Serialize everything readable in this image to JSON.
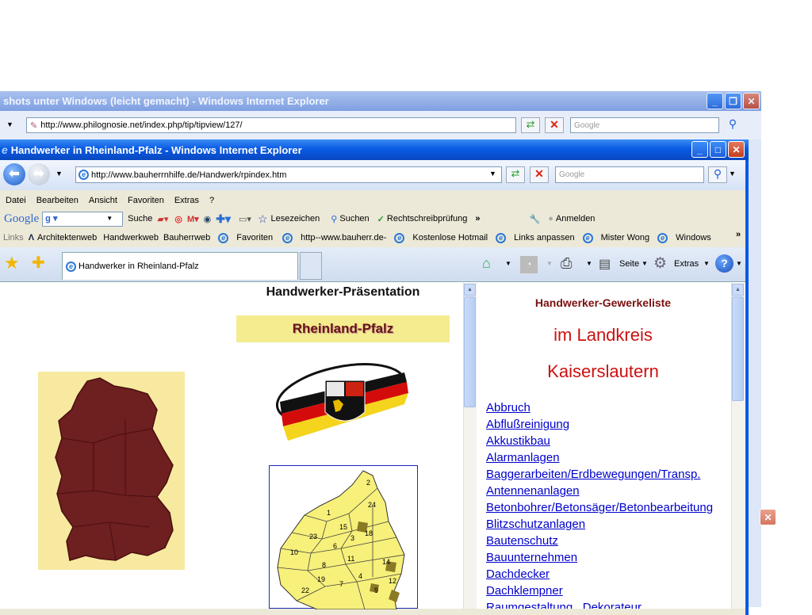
{
  "back_window": {
    "title": "shots unter Windows (leicht gemacht) - Windows Internet Explorer",
    "address": "http://www.philognosie.net/index.php/tip/tipview/127/",
    "search_placeholder": "Google"
  },
  "window": {
    "title": "Handwerker in Rheinland-Pfalz - Windows Internet Explorer",
    "address": "http://www.bauherrnhilfe.de/Handwerk/rpindex.htm",
    "search_placeholder": "Google"
  },
  "menu": [
    "Datei",
    "Bearbeiten",
    "Ansicht",
    "Favoriten",
    "Extras",
    "?"
  ],
  "google_toolbar": {
    "logo": "Google",
    "search_btn": "Suche",
    "bookmarks": "Lesezeichen",
    "search2": "Suchen",
    "spell": "Rechtschreibprüfung",
    "signin": "Anmelden"
  },
  "links_bar": {
    "label": "Links",
    "items": [
      "Architektenweb",
      "Handwerkweb",
      "Bauherrweb",
      "Favoriten",
      "http--www.bauherr.de-",
      "Kostenlose Hotmail",
      "Links anpassen",
      "Mister Wong",
      "Windows"
    ]
  },
  "tab": {
    "label": "Handwerker in Rheinland-Pfalz"
  },
  "command_bar": {
    "page": "Seite",
    "extras": "Extras"
  },
  "page": {
    "heading": "Handwerker-Präsentation",
    "banner": "Rheinland-Pfalz",
    "list_title": "Handwerker-Gewerkeliste",
    "region_line1": "im Landkreis",
    "region_line2": "Kaiserslautern",
    "trades": [
      "Abbruch",
      "Abflußreinigung",
      "Akkustikbau",
      "Alarmanlagen",
      "Baggerarbeiten/Erdbewegungen/Transp.",
      "Antennenanlagen",
      "Betonbohrer/Betonsäger/Betonbearbeitung",
      "Blitzschutzanlagen",
      "Bautenschutz",
      "Bauunternehmen",
      "Dachdecker",
      "Dachklempner",
      "Raumgestaltung , Dekorateur"
    ],
    "map_numbers": [
      "2",
      "24",
      "1",
      "15",
      "18",
      "10",
      "23",
      "6",
      "11",
      "8",
      "3",
      "14",
      "7",
      "9",
      "22",
      "4",
      "19",
      "12"
    ]
  },
  "colors": {
    "xp_blue": "#0a5ae3",
    "toolbar_bg": "#ece9d8",
    "link": "#0000cc",
    "dark_red": "#7a1010",
    "region_red": "#cc1111"
  }
}
